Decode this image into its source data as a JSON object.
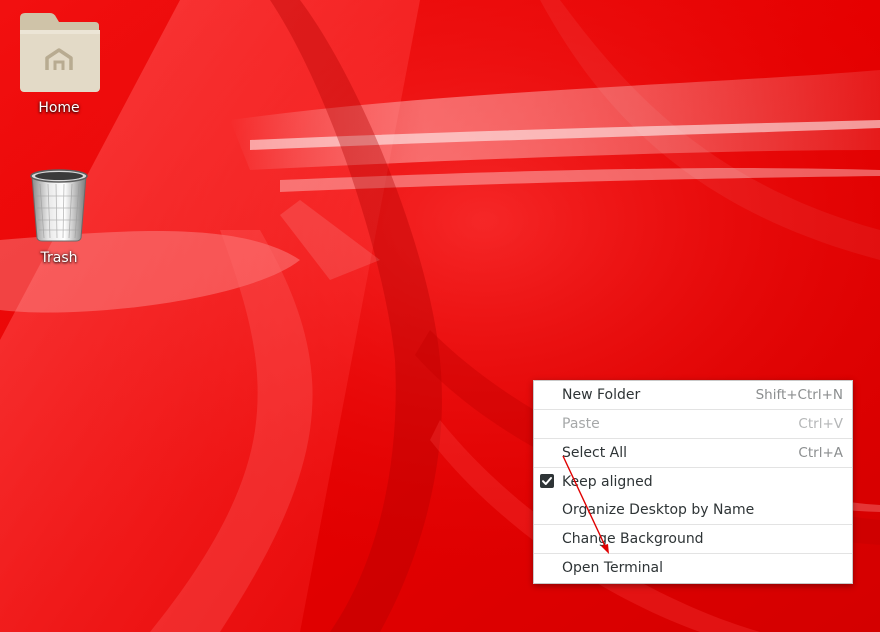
{
  "desktop": {
    "icons": [
      {
        "label": "Home",
        "icon": "folder-home-icon"
      },
      {
        "label": "Trash",
        "icon": "trash-icon"
      }
    ]
  },
  "context_menu": {
    "items": [
      {
        "label": "New Folder",
        "accel": "Shift+Ctrl+N",
        "enabled": true
      },
      {
        "label": "Paste",
        "accel": "Ctrl+V",
        "enabled": false
      },
      {
        "label": "Select All",
        "accel": "Ctrl+A",
        "enabled": true
      },
      {
        "label": "Keep aligned",
        "accel": "",
        "enabled": true,
        "checked": true
      },
      {
        "label": "Organize Desktop by Name",
        "accel": "",
        "enabled": true
      },
      {
        "label": "Change Background",
        "accel": "",
        "enabled": true
      },
      {
        "label": "Open Terminal",
        "accel": "",
        "enabled": true
      }
    ]
  },
  "colors": {
    "wallpaper_base": "#e80000",
    "wallpaper_highlight": "#ff6a6a",
    "menu_bg": "#ffffff",
    "menu_text": "#2e3436",
    "menu_disabled_text": "#a6a8a9",
    "annotation_arrow": "#e00000"
  }
}
